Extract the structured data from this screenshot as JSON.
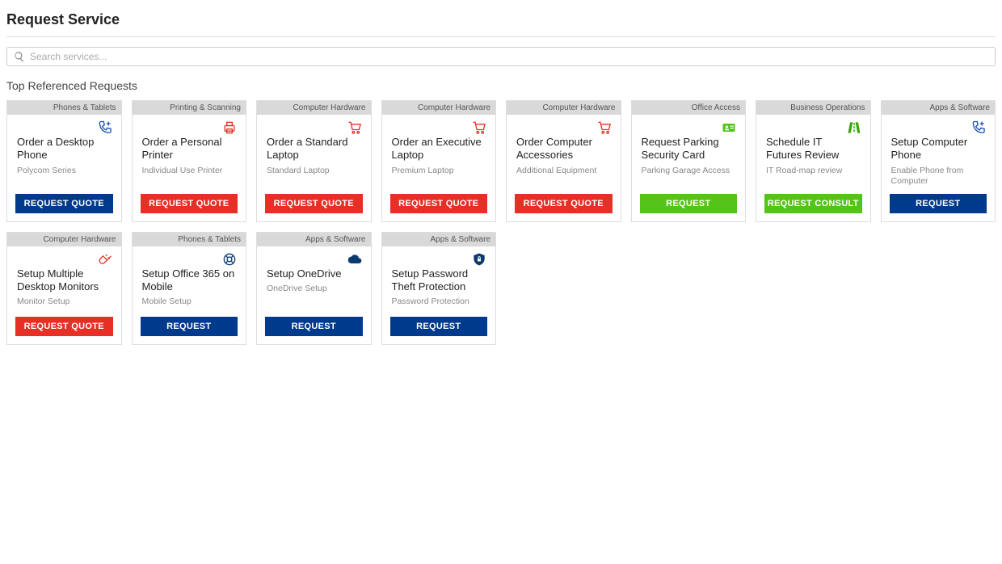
{
  "page": {
    "title": "Request Service",
    "section": "Top Referenced Requests"
  },
  "search": {
    "placeholder": "Search services..."
  },
  "buttons": {
    "request_quote": "REQUEST QUOTE",
    "request": "REQUEST",
    "request_consult": "REQUEST CONSULT"
  },
  "cards": [
    {
      "category": "Phones & Tablets",
      "title": "Order a Desktop Phone",
      "sub": "Polycom Series",
      "btn": "request_quote",
      "btnStyle": "blue",
      "icon": "phone-plus"
    },
    {
      "category": "Printing & Scanning",
      "title": "Order a Personal Printer",
      "sub": "Individual Use Printer",
      "btn": "request_quote",
      "btnStyle": "red",
      "icon": "printer"
    },
    {
      "category": "Computer Hardware",
      "title": "Order a Standard Laptop",
      "sub": "Standard Laptop",
      "btn": "request_quote",
      "btnStyle": "red",
      "icon": "cart"
    },
    {
      "category": "Computer Hardware",
      "title": "Order an Executive Laptop",
      "sub": "Premium Laptop",
      "btn": "request_quote",
      "btnStyle": "red",
      "icon": "cart"
    },
    {
      "category": "Computer Hardware",
      "title": "Order Computer Accessories",
      "sub": "Additional Equipment",
      "btn": "request_quote",
      "btnStyle": "red",
      "icon": "cart"
    },
    {
      "category": "Office Access",
      "title": "Request Parking Security Card",
      "sub": "Parking Garage Access",
      "btn": "request",
      "btnStyle": "green",
      "icon": "id-card"
    },
    {
      "category": "Business Operations",
      "title": "Schedule IT Futures Review",
      "sub": "IT Road-map review",
      "btn": "request_consult",
      "btnStyle": "green",
      "icon": "road"
    },
    {
      "category": "Apps & Software",
      "title": "Setup Computer Phone",
      "sub": "Enable Phone from Computer",
      "btn": "request",
      "btnStyle": "blue",
      "icon": "phone-plus"
    },
    {
      "category": "Computer Hardware",
      "title": "Setup Multiple Desktop Monitors",
      "sub": "Monitor Setup",
      "btn": "request_quote",
      "btnStyle": "red",
      "icon": "plug"
    },
    {
      "category": "Phones & Tablets",
      "title": "Setup Office 365 on Mobile",
      "sub": "Mobile Setup",
      "btn": "request",
      "btnStyle": "blue",
      "icon": "lifebuoy"
    },
    {
      "category": "Apps & Software",
      "title": "Setup OneDrive",
      "sub": "OneDrive Setup",
      "btn": "request",
      "btnStyle": "blue",
      "icon": "cloud"
    },
    {
      "category": "Apps & Software",
      "title": "Setup Password Theft Protection",
      "sub": "Password Protection",
      "btn": "request",
      "btnStyle": "blue",
      "icon": "shield-lock"
    }
  ]
}
